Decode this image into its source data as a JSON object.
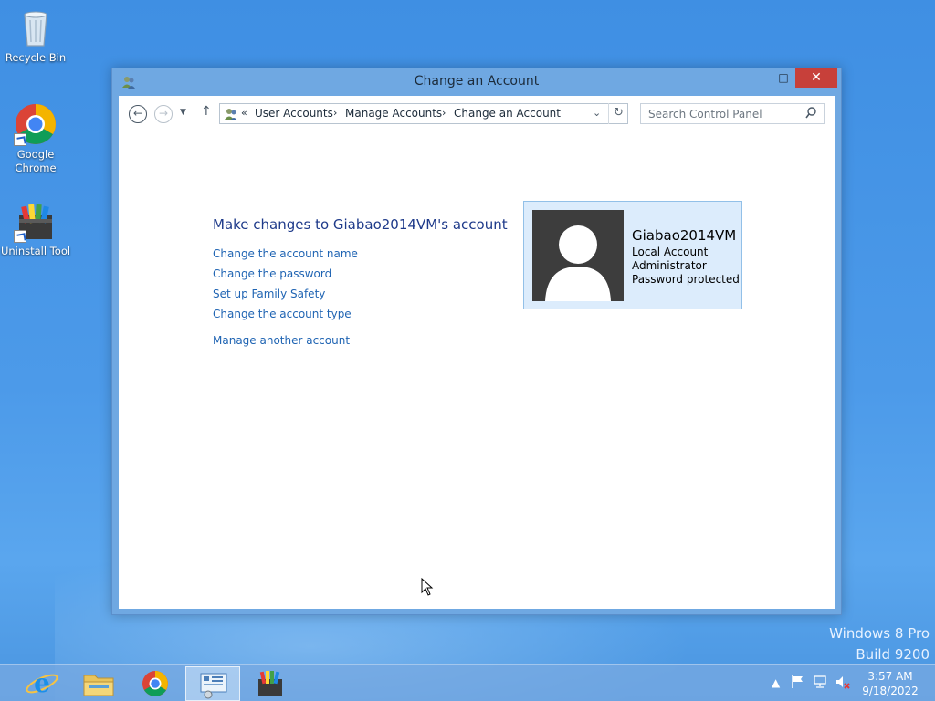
{
  "desktop": {
    "icons": [
      {
        "label": "Recycle Bin"
      },
      {
        "label": "Google Chrome"
      },
      {
        "label": "Uninstall Tool"
      }
    ],
    "watermark": {
      "line1": "Windows 8 Pro",
      "line2": "Build 9200"
    }
  },
  "window": {
    "title": "Change an Account",
    "buttons": {
      "minimize": "–",
      "maximize": "□",
      "close": "✕"
    },
    "address": {
      "overflow": "«",
      "crumbs": [
        "User Accounts",
        "Manage Accounts",
        "Change an Account"
      ]
    },
    "search_placeholder": "Search Control Panel",
    "heading": "Make changes to Giabao2014VM's account",
    "links": [
      "Change the account name",
      "Change the password",
      "Set up Family Safety",
      "Change the account type",
      "Manage another account"
    ],
    "account": {
      "name": "Giabao2014VM",
      "type": "Local Account",
      "role": "Administrator",
      "status": "Password protected"
    }
  },
  "taskbar": {
    "items": [
      "internet-explorer-icon",
      "file-explorer-icon",
      "chrome-icon",
      "control-panel-icon",
      "uninstall-tool-icon"
    ],
    "active_item": "control-panel-icon",
    "clock": {
      "time": "3:57 AM",
      "date": "9/18/2022"
    }
  },
  "colors": {
    "desktop": "#4a95e0",
    "window_frame": "#6fa8e2",
    "close_button": "#c7403a",
    "link": "#1f64b3",
    "heading": "#1e3a8a",
    "account_card": "#dcecfc"
  }
}
